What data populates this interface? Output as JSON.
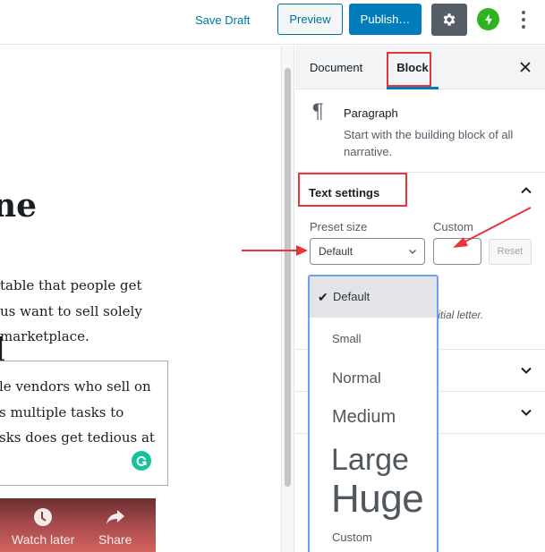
{
  "topbar": {
    "save_draft": "Save Draft",
    "preview": "Preview",
    "publish": "Publish…",
    "settings_icon": "gear-icon",
    "jetpack_icon": "jetpack-bolt-icon",
    "more_icon": "more-vertical-icon"
  },
  "editor": {
    "heading_lines": [
      "ne",
      "l"
    ],
    "paragraph_lines": [
      "table that people get",
      "us want to sell solely",
      "marketplace."
    ],
    "quote_lines": [
      "le vendors who sell on",
      "s multiple tasks to",
      "sks does get tedious at"
    ],
    "grammarly_icon": "grammarly-icon",
    "video_actions": [
      {
        "label": "Watch later",
        "icon": "clock-icon"
      },
      {
        "label": "Share",
        "icon": "share-icon"
      }
    ]
  },
  "sidebar": {
    "tabs": [
      {
        "label": "Document",
        "active": false
      },
      {
        "label": "Block",
        "active": true
      }
    ],
    "close_label": "×",
    "block": {
      "icon": "¶",
      "title": "Paragraph",
      "description": "Start with the building block of all narrative."
    },
    "text_settings": {
      "title": "Text settings",
      "preset_label": "Preset size",
      "custom_label": "Custom",
      "preset_value": "Default",
      "custom_value": "",
      "reset_label": "Reset",
      "dropcap_hint": "initial letter."
    }
  },
  "dropdown": {
    "selected": "Default",
    "options": [
      "Default",
      "Small",
      "Normal",
      "Medium",
      "Large",
      "Huge",
      "Custom"
    ]
  },
  "colors": {
    "accent": "#007cba",
    "annotation": "#e8343b",
    "dropdown_focus": "#6aa0f8",
    "jetpack": "#2fb41f",
    "grammarly": "#15c39a"
  }
}
